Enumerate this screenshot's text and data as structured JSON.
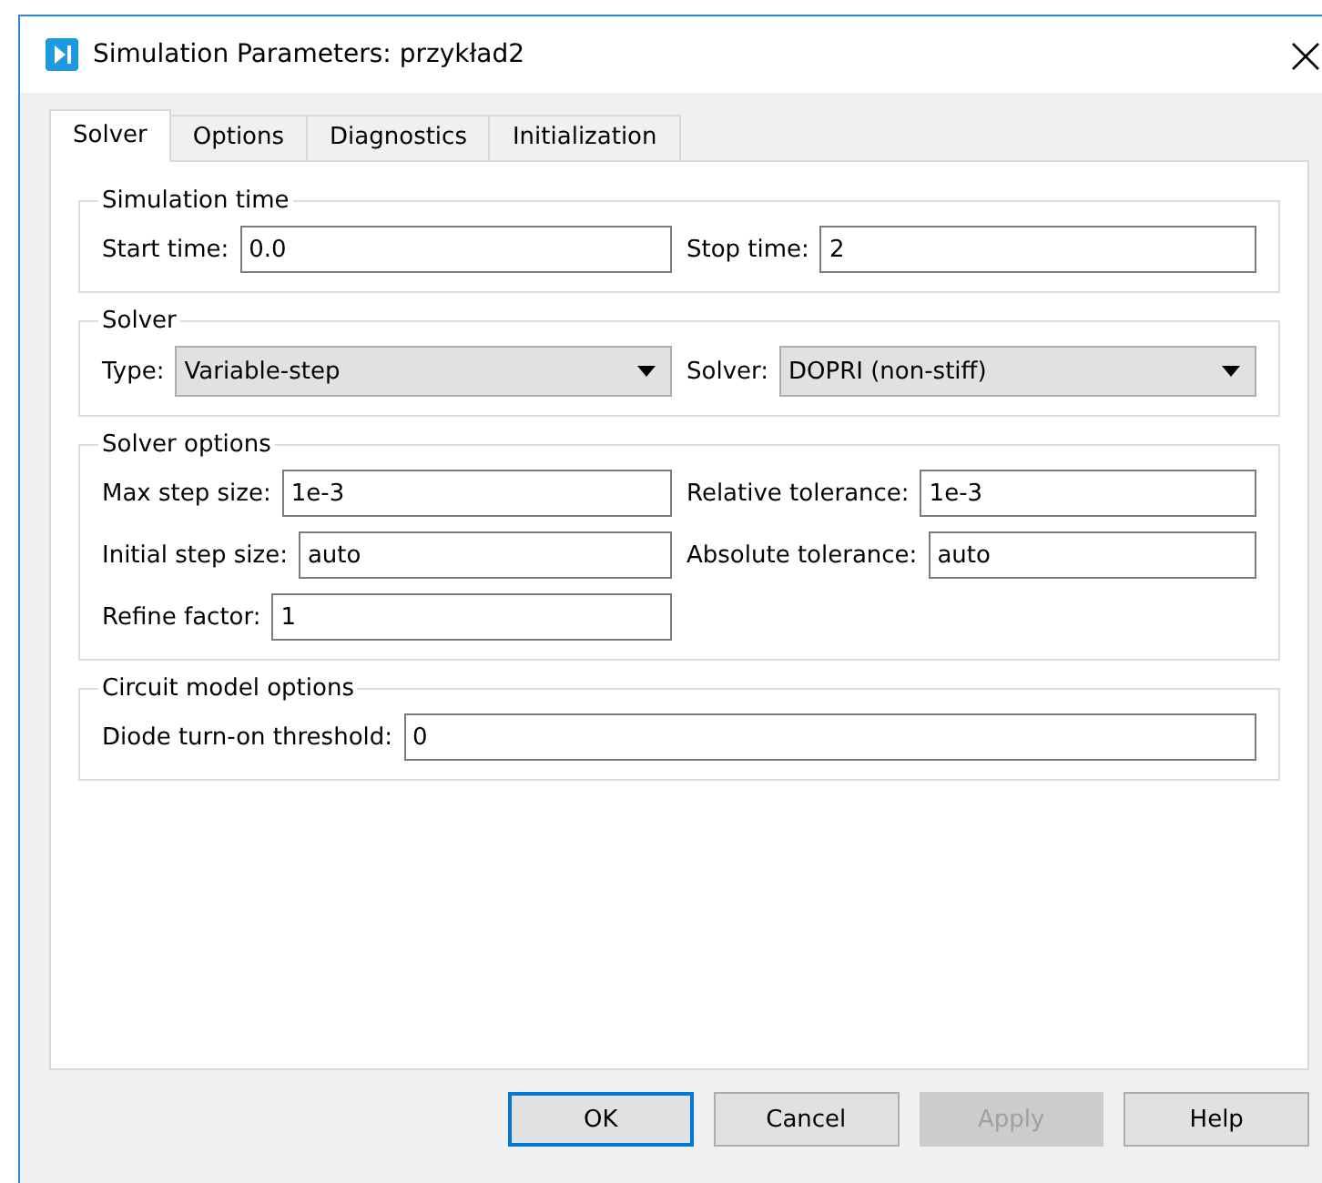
{
  "window": {
    "title": "Simulation Parameters: przykład2"
  },
  "tabs": [
    {
      "label": "Solver",
      "selected": true
    },
    {
      "label": "Options",
      "selected": false
    },
    {
      "label": "Diagnostics",
      "selected": false
    },
    {
      "label": "Initialization",
      "selected": false
    }
  ],
  "groups": [
    {
      "title": "Simulation time",
      "rows": [
        [
          {
            "kind": "field",
            "label": "Start time:",
            "value": "0.0"
          },
          {
            "kind": "field",
            "label": "Stop time:",
            "value": "2"
          }
        ]
      ]
    },
    {
      "title": "Solver",
      "rows": [
        [
          {
            "kind": "dropdown",
            "label": "Type:",
            "value": "Variable-step"
          },
          {
            "kind": "dropdown",
            "label": "Solver:",
            "value": "DOPRI (non-stiff)"
          }
        ]
      ]
    },
    {
      "title": "Solver options",
      "rows": [
        [
          {
            "kind": "field",
            "label": "Max step size:",
            "value": "1e-3"
          },
          {
            "kind": "field",
            "label": "Relative tolerance:",
            "value": "1e-3"
          }
        ],
        [
          {
            "kind": "field",
            "label": "Initial step size:",
            "value": "auto"
          },
          {
            "kind": "field",
            "label": "Absolute tolerance:",
            "value": "auto"
          }
        ],
        [
          {
            "kind": "field",
            "label": "Refine factor:",
            "value": "1"
          }
        ]
      ]
    },
    {
      "title": "Circuit model options",
      "rows": [
        [
          {
            "kind": "wide",
            "label": "Diode turn-on threshold:",
            "value": "0"
          }
        ]
      ]
    }
  ],
  "buttons": [
    {
      "label": "OK",
      "focused": true,
      "disabled": false
    },
    {
      "label": "Cancel",
      "focused": false,
      "disabled": false
    },
    {
      "label": "Apply",
      "focused": false,
      "disabled": true
    },
    {
      "label": "Help",
      "focused": false,
      "disabled": false
    }
  ]
}
